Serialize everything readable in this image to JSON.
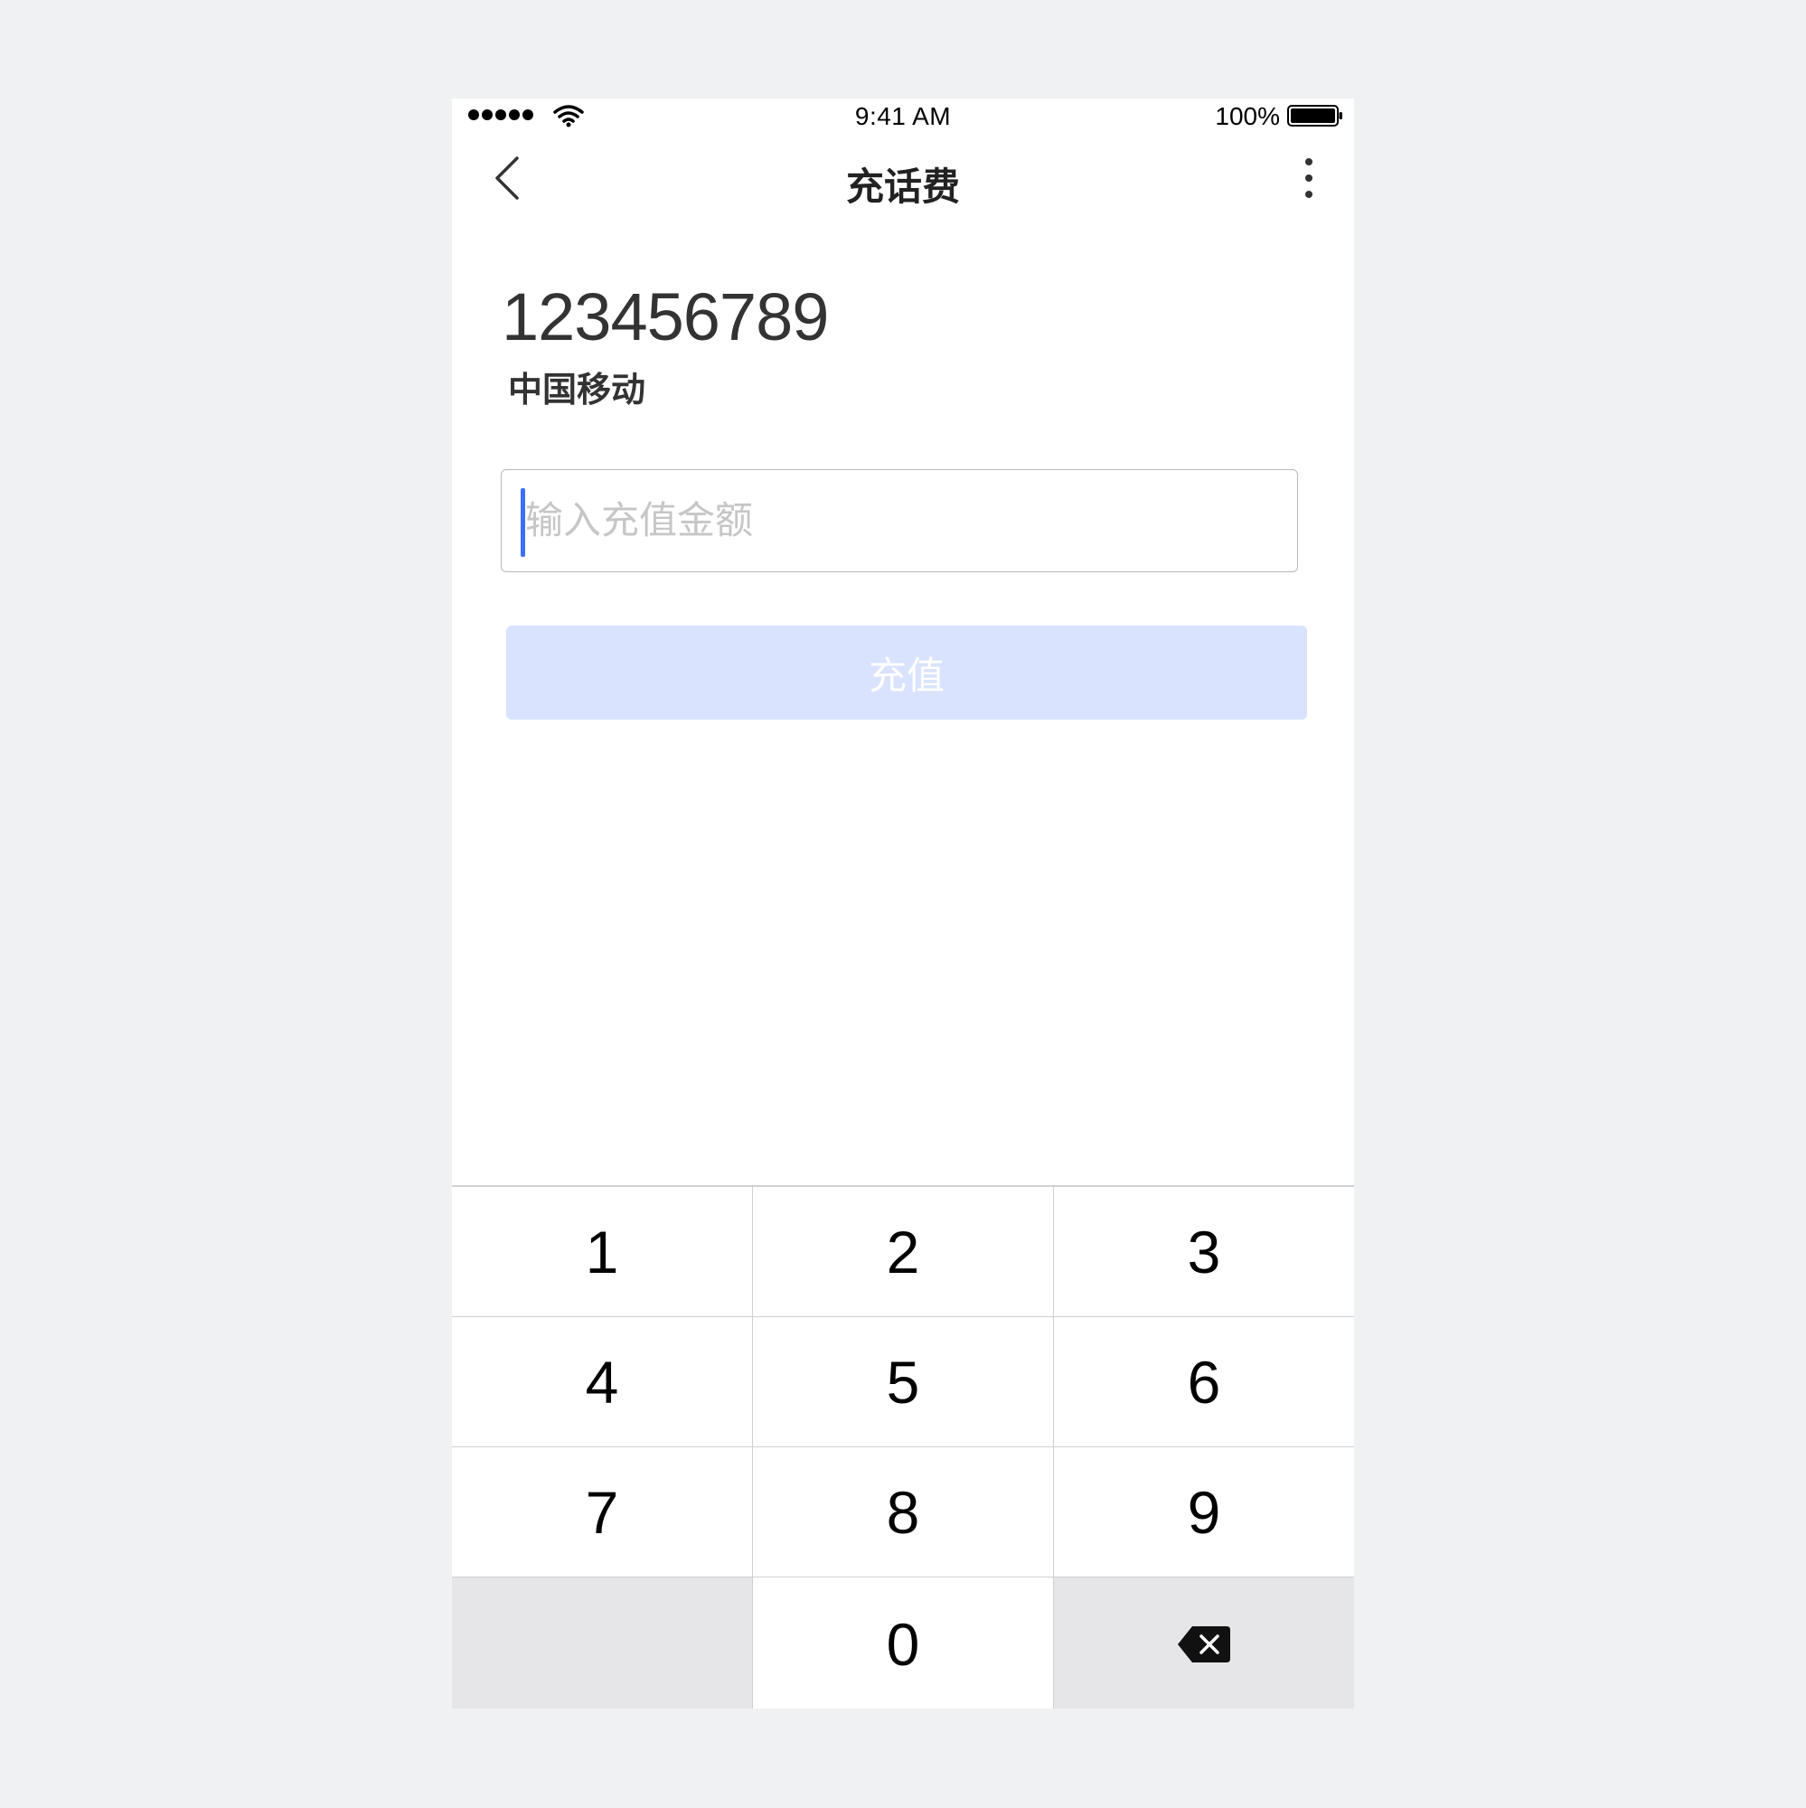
{
  "status_bar": {
    "time": "9:41 AM",
    "battery_percent": "100%",
    "signal_icon": "signal-dots-icon",
    "wifi_icon": "wifi-icon",
    "battery_icon": "battery-full-icon"
  },
  "nav": {
    "title": "充话费",
    "back_icon": "chevron-left-icon",
    "more_icon": "more-vertical-icon"
  },
  "account": {
    "phone_number": "123456789",
    "carrier": "中国移动"
  },
  "amount_input": {
    "placeholder": "输入充值金额",
    "value": ""
  },
  "submit": {
    "label": "充值",
    "enabled": false
  },
  "keypad": {
    "keys": [
      "1",
      "2",
      "3",
      "4",
      "5",
      "6",
      "7",
      "8",
      "9",
      "",
      "0",
      "delete"
    ],
    "delete_icon": "backspace-icon"
  },
  "colors": {
    "accent": "#3b6ff5",
    "button_disabled_bg": "#d9e3fd",
    "page_bg": "#f0f1f3",
    "keypad_gray": "#e6e6e9"
  }
}
